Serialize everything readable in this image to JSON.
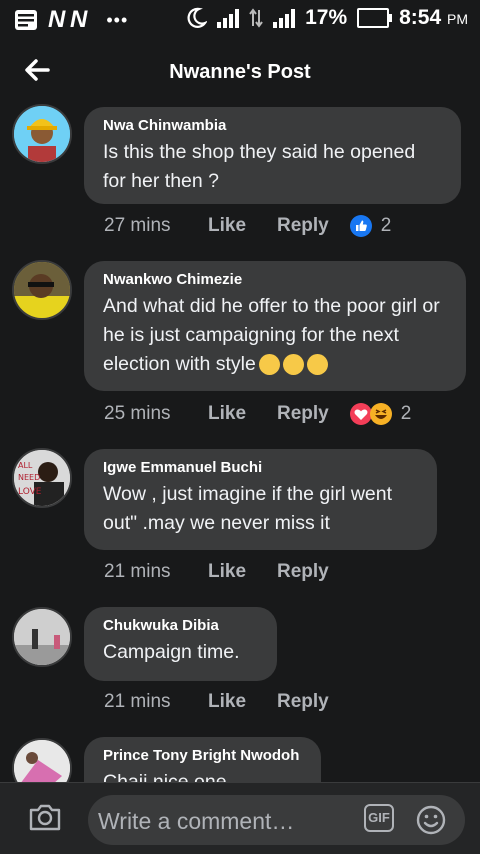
{
  "status_bar": {
    "app_glyph": "N N",
    "battery": "17%",
    "time": "8:54",
    "ampm": "PM"
  },
  "header": {
    "title": "Nwanne's Post"
  },
  "comments": [
    {
      "author": "Nwa Chinwambia",
      "text": "Is this the shop they said he opened for her then ?",
      "time": "27 mins",
      "like": "Like",
      "reply": "Reply",
      "reaction_count": "2",
      "reaction_icons": [
        "like-icon"
      ]
    },
    {
      "author": "Nwankwo Chimezie",
      "text": "And what did he offer to the poor girl or he is just campaigning for the next election with style",
      "time": "25 mins",
      "like": "Like",
      "reply": "Reply",
      "reaction_count": "2",
      "reaction_icons": [
        "love-icon",
        "haha-icon"
      ]
    },
    {
      "author": "Igwe Emmanuel Buchi",
      "text": "Wow , just imagine if the girl went out\" .may we never miss it",
      "time": "21 mins",
      "like": "Like",
      "reply": "Reply"
    },
    {
      "author": "Chukwuka Dibia",
      "text": "Campaign time.",
      "time": "21 mins",
      "like": "Like",
      "reply": "Reply"
    },
    {
      "author": "Prince Tony Bright Nwodoh",
      "text": "Chaii nice one"
    }
  ],
  "composer": {
    "placeholder": "Write a comment…",
    "gif_label": "GIF"
  },
  "colors": {
    "background": "#18191a",
    "bubble": "#3a3b3c",
    "like_blue": "#1877f2",
    "love_red": "#f33e58"
  }
}
